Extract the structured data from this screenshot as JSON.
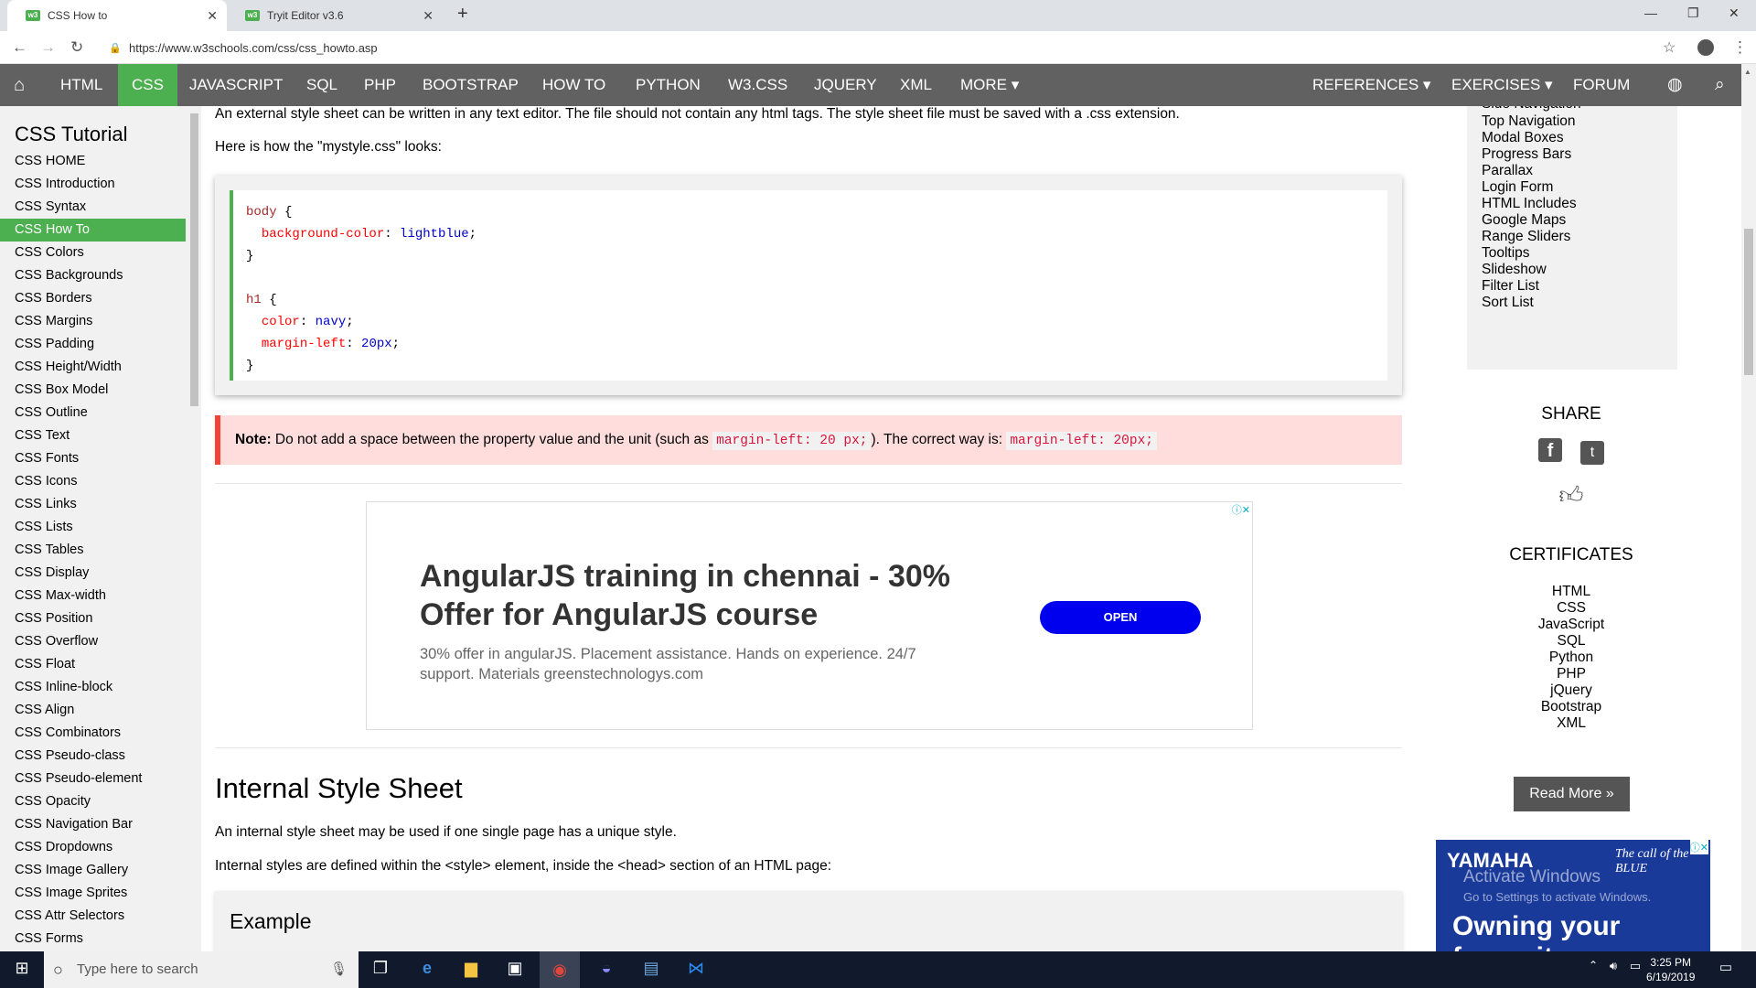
{
  "browser": {
    "tabs": [
      {
        "title": "CSS How to",
        "active": true
      },
      {
        "title": "Tryit Editor v3.6",
        "active": false
      }
    ],
    "url": "https://www.w3schools.com/css/css_howto.asp"
  },
  "topnav": {
    "items": [
      "HTML",
      "CSS",
      "JAVASCRIPT",
      "SQL",
      "PHP",
      "BOOTSTRAP",
      "HOW TO",
      "PYTHON",
      "W3.CSS",
      "JQUERY",
      "XML",
      "MORE ▾"
    ],
    "right": [
      "REFERENCES ▾",
      "EXERCISES ▾",
      "FORUM"
    ]
  },
  "sidebar": {
    "title": "CSS Tutorial",
    "items": [
      "CSS HOME",
      "CSS Introduction",
      "CSS Syntax",
      "CSS How To",
      "CSS Colors",
      "CSS Backgrounds",
      "CSS Borders",
      "CSS Margins",
      "CSS Padding",
      "CSS Height/Width",
      "CSS Box Model",
      "CSS Outline",
      "CSS Text",
      "CSS Fonts",
      "CSS Icons",
      "CSS Links",
      "CSS Lists",
      "CSS Tables",
      "CSS Display",
      "CSS Max-width",
      "CSS Position",
      "CSS Overflow",
      "CSS Float",
      "CSS Inline-block",
      "CSS Align",
      "CSS Combinators",
      "CSS Pseudo-class",
      "CSS Pseudo-element",
      "CSS Opacity",
      "CSS Navigation Bar",
      "CSS Dropdowns",
      "CSS Image Gallery",
      "CSS Image Sprites",
      "CSS Attr Selectors",
      "CSS Forms"
    ],
    "active_index": 3
  },
  "main": {
    "intro": "An external style sheet can be written in any text editor. The file should not contain any html tags. The style sheet file must be saved with a .css extension.",
    "looks": "Here is how the \"mystyle.css\" looks:",
    "code": {
      "l1_sel": "body",
      "l1_open": " {",
      "l2_prop": "background-color",
      "l2_val": " lightblue",
      "l3": "}",
      "l5_sel": "h1",
      "l5_open": " {",
      "l6_prop": "color",
      "l6_val": " navy",
      "l7_prop": "margin-left",
      "l7_val": " 20px",
      "l8": "}"
    },
    "note": {
      "label": "Note:",
      "text1": " Do not add a space between the property value and the unit (such as ",
      "code1": "margin-left: 20 px;",
      "text2": "). The correct way is: ",
      "code2": "margin-left: 20px;"
    },
    "ad": {
      "title": "AngularJS training in chennai - 30% Offer for AngularJS course",
      "desc": "30% offer in angularJS. Placement assistance. Hands on experience. 24/7 support. Materials greenstechnologys.com",
      "button": "OPEN"
    },
    "internal_heading": "Internal Style Sheet",
    "internal_p1": "An internal style sheet may be used if one single page has a unique style.",
    "internal_p2": "Internal styles are defined within the <style> element, inside the <head> section of an HTML page:",
    "example_title": "Example"
  },
  "right": {
    "howto_partial": "Side Navigation",
    "howto_items": [
      "Top Navigation",
      "Modal Boxes",
      "Progress Bars",
      "Parallax",
      "Login Form",
      "HTML Includes",
      "Google Maps",
      "Range Sliders",
      "Tooltips",
      "Slideshow",
      "Filter List",
      "Sort List"
    ],
    "share_title": "SHARE",
    "certificates_title": "CERTIFICATES",
    "certificates": [
      "HTML",
      "CSS",
      "JavaScript",
      "SQL",
      "Python",
      "PHP",
      "jQuery",
      "Bootstrap",
      "XML"
    ],
    "read_more": "Read More »",
    "yamaha_brand": "YAMAHA",
    "yamaha_tag": "The call of the BLUE",
    "yamaha_line": "Owning your favourite",
    "activate_title": "Activate Windows",
    "activate_sub": "Go to Settings to activate Windows."
  },
  "taskbar": {
    "search_placeholder": "Type here to search",
    "time": "3:25 PM",
    "date": "6/19/2019"
  }
}
